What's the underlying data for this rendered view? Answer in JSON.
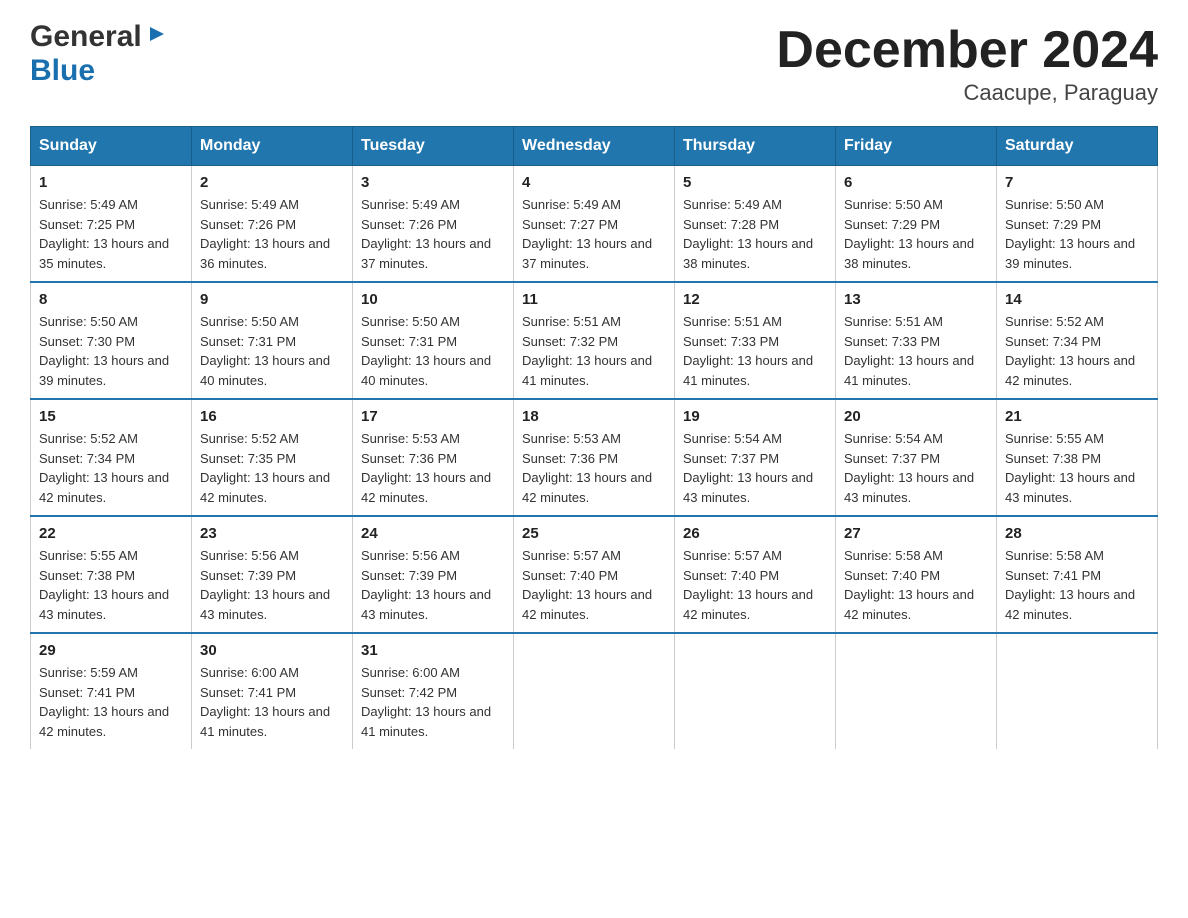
{
  "logo": {
    "general": "General",
    "arrow": "▶",
    "blue": "Blue"
  },
  "title": "December 2024",
  "location": "Caacupe, Paraguay",
  "days_of_week": [
    "Sunday",
    "Monday",
    "Tuesday",
    "Wednesday",
    "Thursday",
    "Friday",
    "Saturday"
  ],
  "weeks": [
    [
      {
        "day": "1",
        "sunrise": "5:49 AM",
        "sunset": "7:25 PM",
        "daylight": "13 hours and 35 minutes."
      },
      {
        "day": "2",
        "sunrise": "5:49 AM",
        "sunset": "7:26 PM",
        "daylight": "13 hours and 36 minutes."
      },
      {
        "day": "3",
        "sunrise": "5:49 AM",
        "sunset": "7:26 PM",
        "daylight": "13 hours and 37 minutes."
      },
      {
        "day": "4",
        "sunrise": "5:49 AM",
        "sunset": "7:27 PM",
        "daylight": "13 hours and 37 minutes."
      },
      {
        "day": "5",
        "sunrise": "5:49 AM",
        "sunset": "7:28 PM",
        "daylight": "13 hours and 38 minutes."
      },
      {
        "day": "6",
        "sunrise": "5:50 AM",
        "sunset": "7:29 PM",
        "daylight": "13 hours and 38 minutes."
      },
      {
        "day": "7",
        "sunrise": "5:50 AM",
        "sunset": "7:29 PM",
        "daylight": "13 hours and 39 minutes."
      }
    ],
    [
      {
        "day": "8",
        "sunrise": "5:50 AM",
        "sunset": "7:30 PM",
        "daylight": "13 hours and 39 minutes."
      },
      {
        "day": "9",
        "sunrise": "5:50 AM",
        "sunset": "7:31 PM",
        "daylight": "13 hours and 40 minutes."
      },
      {
        "day": "10",
        "sunrise": "5:50 AM",
        "sunset": "7:31 PM",
        "daylight": "13 hours and 40 minutes."
      },
      {
        "day": "11",
        "sunrise": "5:51 AM",
        "sunset": "7:32 PM",
        "daylight": "13 hours and 41 minutes."
      },
      {
        "day": "12",
        "sunrise": "5:51 AM",
        "sunset": "7:33 PM",
        "daylight": "13 hours and 41 minutes."
      },
      {
        "day": "13",
        "sunrise": "5:51 AM",
        "sunset": "7:33 PM",
        "daylight": "13 hours and 41 minutes."
      },
      {
        "day": "14",
        "sunrise": "5:52 AM",
        "sunset": "7:34 PM",
        "daylight": "13 hours and 42 minutes."
      }
    ],
    [
      {
        "day": "15",
        "sunrise": "5:52 AM",
        "sunset": "7:34 PM",
        "daylight": "13 hours and 42 minutes."
      },
      {
        "day": "16",
        "sunrise": "5:52 AM",
        "sunset": "7:35 PM",
        "daylight": "13 hours and 42 minutes."
      },
      {
        "day": "17",
        "sunrise": "5:53 AM",
        "sunset": "7:36 PM",
        "daylight": "13 hours and 42 minutes."
      },
      {
        "day": "18",
        "sunrise": "5:53 AM",
        "sunset": "7:36 PM",
        "daylight": "13 hours and 42 minutes."
      },
      {
        "day": "19",
        "sunrise": "5:54 AM",
        "sunset": "7:37 PM",
        "daylight": "13 hours and 43 minutes."
      },
      {
        "day": "20",
        "sunrise": "5:54 AM",
        "sunset": "7:37 PM",
        "daylight": "13 hours and 43 minutes."
      },
      {
        "day": "21",
        "sunrise": "5:55 AM",
        "sunset": "7:38 PM",
        "daylight": "13 hours and 43 minutes."
      }
    ],
    [
      {
        "day": "22",
        "sunrise": "5:55 AM",
        "sunset": "7:38 PM",
        "daylight": "13 hours and 43 minutes."
      },
      {
        "day": "23",
        "sunrise": "5:56 AM",
        "sunset": "7:39 PM",
        "daylight": "13 hours and 43 minutes."
      },
      {
        "day": "24",
        "sunrise": "5:56 AM",
        "sunset": "7:39 PM",
        "daylight": "13 hours and 43 minutes."
      },
      {
        "day": "25",
        "sunrise": "5:57 AM",
        "sunset": "7:40 PM",
        "daylight": "13 hours and 42 minutes."
      },
      {
        "day": "26",
        "sunrise": "5:57 AM",
        "sunset": "7:40 PM",
        "daylight": "13 hours and 42 minutes."
      },
      {
        "day": "27",
        "sunrise": "5:58 AM",
        "sunset": "7:40 PM",
        "daylight": "13 hours and 42 minutes."
      },
      {
        "day": "28",
        "sunrise": "5:58 AM",
        "sunset": "7:41 PM",
        "daylight": "13 hours and 42 minutes."
      }
    ],
    [
      {
        "day": "29",
        "sunrise": "5:59 AM",
        "sunset": "7:41 PM",
        "daylight": "13 hours and 42 minutes."
      },
      {
        "day": "30",
        "sunrise": "6:00 AM",
        "sunset": "7:41 PM",
        "daylight": "13 hours and 41 minutes."
      },
      {
        "day": "31",
        "sunrise": "6:00 AM",
        "sunset": "7:42 PM",
        "daylight": "13 hours and 41 minutes."
      },
      null,
      null,
      null,
      null
    ]
  ]
}
